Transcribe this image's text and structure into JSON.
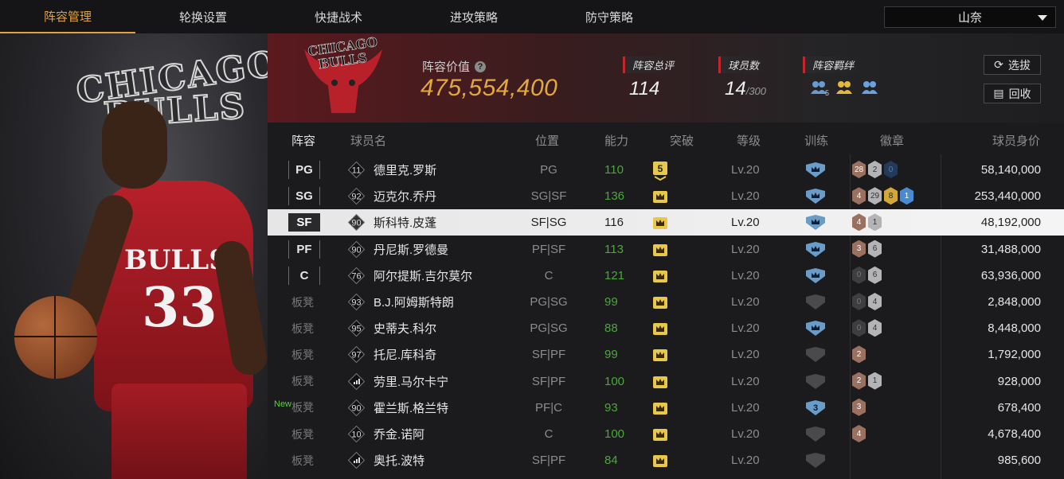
{
  "nav": {
    "tabs": [
      "阵容管理",
      "轮换设置",
      "快捷战术",
      "进攻策略",
      "防守策略"
    ],
    "active_tab": "阵容管理",
    "team_select": "山奈"
  },
  "art": {
    "logo_text_1": "CHICAGO",
    "logo_text_2": "BULLS",
    "jersey_text": "BULLS",
    "jersey_number": "33"
  },
  "header": {
    "logo_text_1": "CHICAGO",
    "logo_text_2": "BULLS",
    "value_label": "阵容价值",
    "help_icon": "?",
    "value": "475,554,400",
    "overall_label": "阵容总评",
    "overall_value": "114",
    "players_label": "球员数",
    "players_value": "14",
    "players_max": "/300",
    "bond_label": "阵容羁绊",
    "bond_icons": [
      {
        "name": "bond-icon-blue",
        "sub": "5"
      },
      {
        "name": "bond-icon-gold",
        "sub": ""
      },
      {
        "name": "bond-icon-blue",
        "sub": ""
      }
    ],
    "draft_button": "选拔",
    "recycle_button": "回收"
  },
  "colors": {
    "accent_gold": "#e3a83c",
    "ability_green": "#4aa83a",
    "stat_red": "#c4262c",
    "new_green": "#5bd13a"
  },
  "table": {
    "columns": [
      "阵容",
      "球员名",
      "位置",
      "能力",
      "突破",
      "等级",
      "训练",
      "徽章",
      "球员身价"
    ],
    "rows": [
      {
        "slot": "PG",
        "num": "11",
        "name": "德里克.罗斯",
        "pos": "PG",
        "ability": "110",
        "breakthrough": "5",
        "level": "Lv.20",
        "train": "blue",
        "badges": [
          [
            "brown",
            "28"
          ],
          [
            "silver",
            "2"
          ],
          [
            "navy",
            "0"
          ]
        ],
        "value": "58,140,000"
      },
      {
        "slot": "SG",
        "num": "92",
        "name": "迈克尔.乔丹",
        "pos": "SG|SF",
        "ability": "136",
        "breakthrough": "",
        "level": "Lv.20",
        "train": "blue",
        "badges": [
          [
            "brown",
            "4"
          ],
          [
            "silver",
            "29"
          ],
          [
            "gold",
            "8"
          ],
          [
            "blue",
            "1"
          ]
        ],
        "value": "253,440,000"
      },
      {
        "slot": "SF",
        "num": "90",
        "name": "斯科特.皮蓬",
        "pos": "SF|SG",
        "ability": "116",
        "breakthrough": "",
        "level": "Lv.20",
        "train": "blue",
        "badges": [
          [
            "brown",
            "4"
          ],
          [
            "silver",
            "1"
          ]
        ],
        "value": "48,192,000",
        "selected": true
      },
      {
        "slot": "PF",
        "num": "90",
        "name": "丹尼斯.罗德曼",
        "pos": "PF|SF",
        "ability": "113",
        "breakthrough": "",
        "level": "Lv.20",
        "train": "blue",
        "badges": [
          [
            "brown",
            "3"
          ],
          [
            "silver",
            "6"
          ]
        ],
        "value": "31,488,000"
      },
      {
        "slot": "C",
        "num": "76",
        "name": "阿尔提斯.吉尔莫尔",
        "pos": "C",
        "ability": "121",
        "breakthrough": "",
        "level": "Lv.20",
        "train": "blue",
        "badges": [
          [
            "dark",
            "0"
          ],
          [
            "silver",
            "6"
          ]
        ],
        "value": "63,936,000"
      },
      {
        "slot": "板凳",
        "num": "93",
        "name": "B.J.阿姆斯特朗",
        "pos": "PG|SG",
        "ability": "99",
        "breakthrough": "",
        "level": "Lv.20",
        "train": "dark",
        "badges": [
          [
            "dark",
            "0"
          ],
          [
            "silver",
            "4"
          ]
        ],
        "value": "2,848,000"
      },
      {
        "slot": "板凳",
        "num": "95",
        "name": "史蒂夫.科尔",
        "pos": "PG|SG",
        "ability": "88",
        "breakthrough": "",
        "level": "Lv.20",
        "train": "blue",
        "badges": [
          [
            "dark",
            "0"
          ],
          [
            "silver",
            "4"
          ]
        ],
        "value": "8,448,000"
      },
      {
        "slot": "板凳",
        "num": "97",
        "name": "托尼.库科奇",
        "pos": "SF|PF",
        "ability": "99",
        "breakthrough": "",
        "level": "Lv.20",
        "train": "dark",
        "badges": [
          [
            "brown",
            "2"
          ]
        ],
        "value": "1,792,000"
      },
      {
        "slot": "板凳",
        "num": "",
        "name": "劳里.马尔卡宁",
        "pos": "SF|PF",
        "ability": "100",
        "breakthrough": "",
        "level": "Lv.20",
        "train": "dark",
        "badges": [
          [
            "brown",
            "2"
          ],
          [
            "silver",
            "1"
          ]
        ],
        "value": "928,000"
      },
      {
        "slot": "板凳",
        "num": "90",
        "name": "霍兰斯.格兰特",
        "pos": "PF|C",
        "ability": "93",
        "breakthrough": "",
        "level": "Lv.20",
        "train": "blue3",
        "badges": [
          [
            "brown",
            "3"
          ]
        ],
        "value": "678,400",
        "new": "New"
      },
      {
        "slot": "板凳",
        "num": "10",
        "name": "乔金.诺阿",
        "pos": "C",
        "ability": "100",
        "breakthrough": "",
        "level": "Lv.20",
        "train": "dark",
        "badges": [
          [
            "brown",
            "4"
          ]
        ],
        "value": "4,678,400"
      },
      {
        "slot": "板凳",
        "num": "",
        "name": "奥托.波特",
        "pos": "SF|PF",
        "ability": "84",
        "breakthrough": "",
        "level": "Lv.20",
        "train": "dark",
        "badges": [],
        "value": "985,600"
      }
    ],
    "train_label_blue3": "3"
  }
}
